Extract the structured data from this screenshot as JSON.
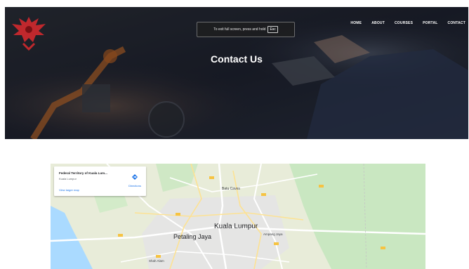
{
  "nav": {
    "items": [
      "HOME",
      "ABOUT",
      "COURSES",
      "PORTAL",
      "CONTACT"
    ]
  },
  "fullscreen_notice": {
    "text": "To exit full screen, press and hold",
    "key": "Esc"
  },
  "hero": {
    "title": "Contact Us"
  },
  "map_card": {
    "title": "Federal Territory of Kuala Lum...",
    "subtitle": "Kuala Lumpur",
    "directions_label": "Directions",
    "larger_map_link": "View larger map"
  },
  "map_labels": {
    "kuala_lumpur": "Kuala Lumpur",
    "petaling_jaya": "Petaling Jaya",
    "batu_caves": "Batu Caves",
    "ampang_jaya": "Ampang Jaya",
    "shah_alam": "Shah Alam"
  },
  "colors": {
    "hero_bg": "#1a1e26",
    "map_land": "#e8ecd9",
    "map_water": "#aadaff",
    "map_green": "#c9e7c1",
    "link_blue": "#1a73e8",
    "logo_red": "#c0282d"
  },
  "icons": {
    "logo": "eagle-logo",
    "directions": "directions-icon"
  }
}
